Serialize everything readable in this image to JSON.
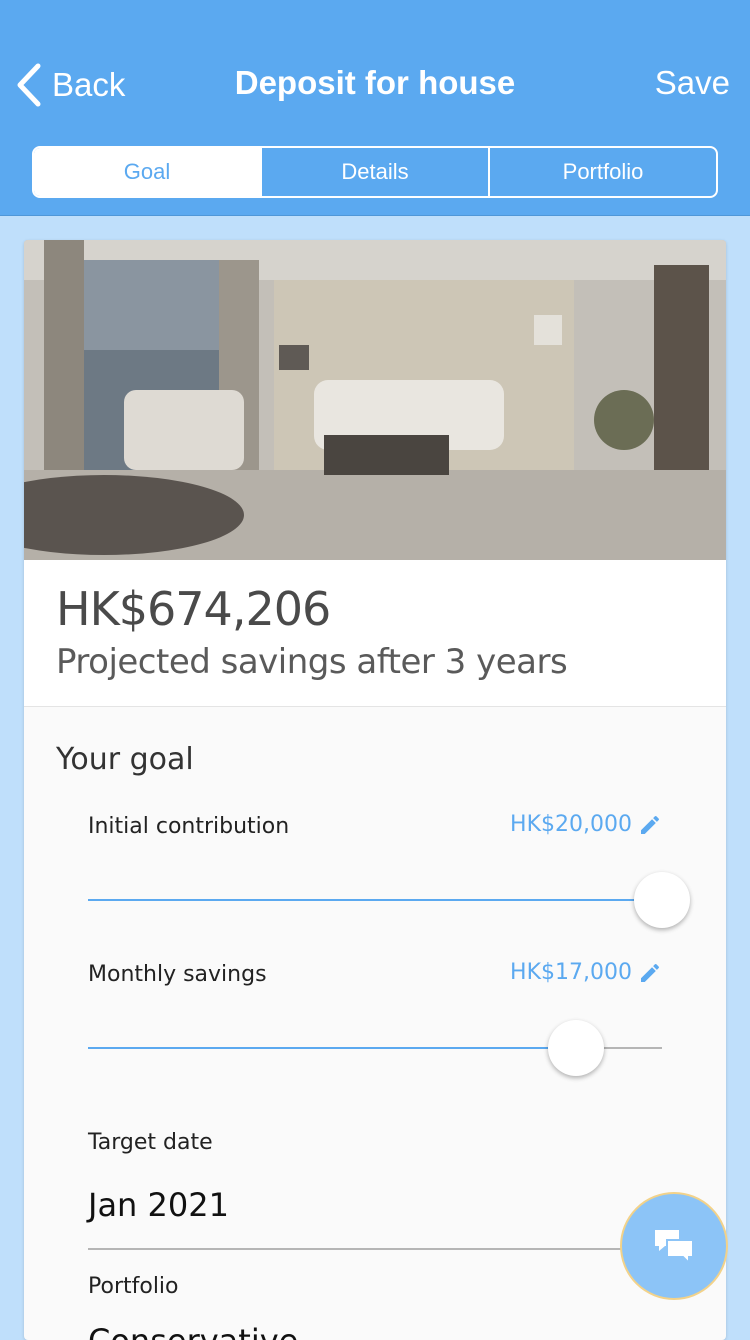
{
  "nav": {
    "back_label": "Back",
    "title": "Deposit for house",
    "save_label": "Save"
  },
  "tabs": [
    {
      "label": "Goal",
      "active": true
    },
    {
      "label": "Details",
      "active": false
    },
    {
      "label": "Portfolio",
      "active": false
    }
  ],
  "summary": {
    "amount": "HK$674,206",
    "subtitle": "Projected savings after 3 years"
  },
  "goal": {
    "section_title": "Your goal",
    "initial_contribution": {
      "label": "Initial contribution",
      "value": "HK$20,000",
      "slider_fraction": 1.0
    },
    "monthly_savings": {
      "label": "Monthly savings",
      "value": "HK$17,000",
      "slider_fraction": 0.85
    },
    "target_date": {
      "label": "Target date",
      "value": "Jan 2021"
    },
    "portfolio": {
      "label": "Portfolio",
      "value": "Conservative"
    }
  },
  "colors": {
    "accent": "#5ba9f0",
    "header_bg": "#5ba9f0",
    "page_bg": "#bfdffb"
  },
  "icons": {
    "back": "chevron-left-icon",
    "edit": "pencil-icon",
    "chat": "chat-bubbles-icon"
  }
}
